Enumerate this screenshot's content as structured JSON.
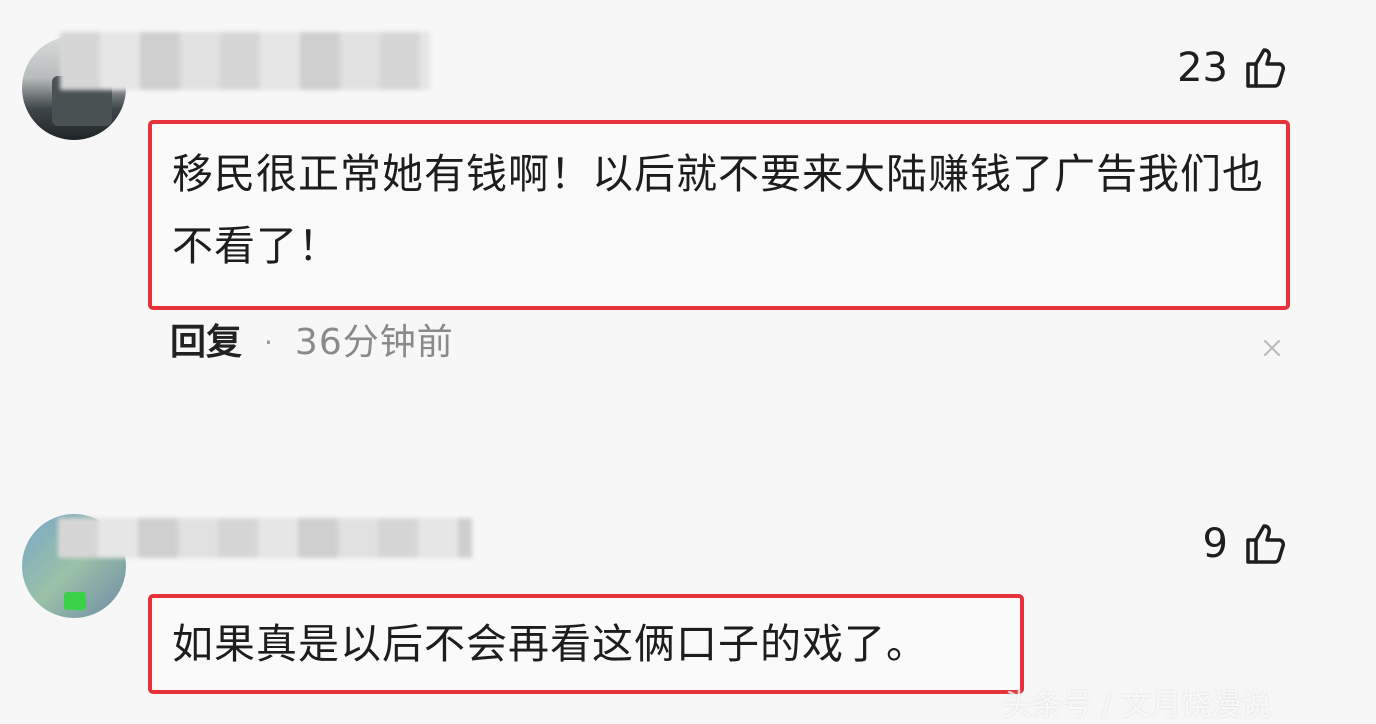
{
  "comments": [
    {
      "likes": "23",
      "text": "移民很正常她有钱啊！以后就不要来大陆赚钱了广告我们也不看了！",
      "reply_label": "回复",
      "separator": "·",
      "time": "36分钟前"
    },
    {
      "likes": "9",
      "text": "如果真是以后不会再看这俩口子的戏了。"
    }
  ],
  "watermark": "头条号 / 文月饶漫说",
  "colors": {
    "highlight_border": "#e5323b",
    "background": "#f7f7f7"
  },
  "icons": {
    "like": "thumbs-up-icon",
    "close": "close-icon"
  }
}
